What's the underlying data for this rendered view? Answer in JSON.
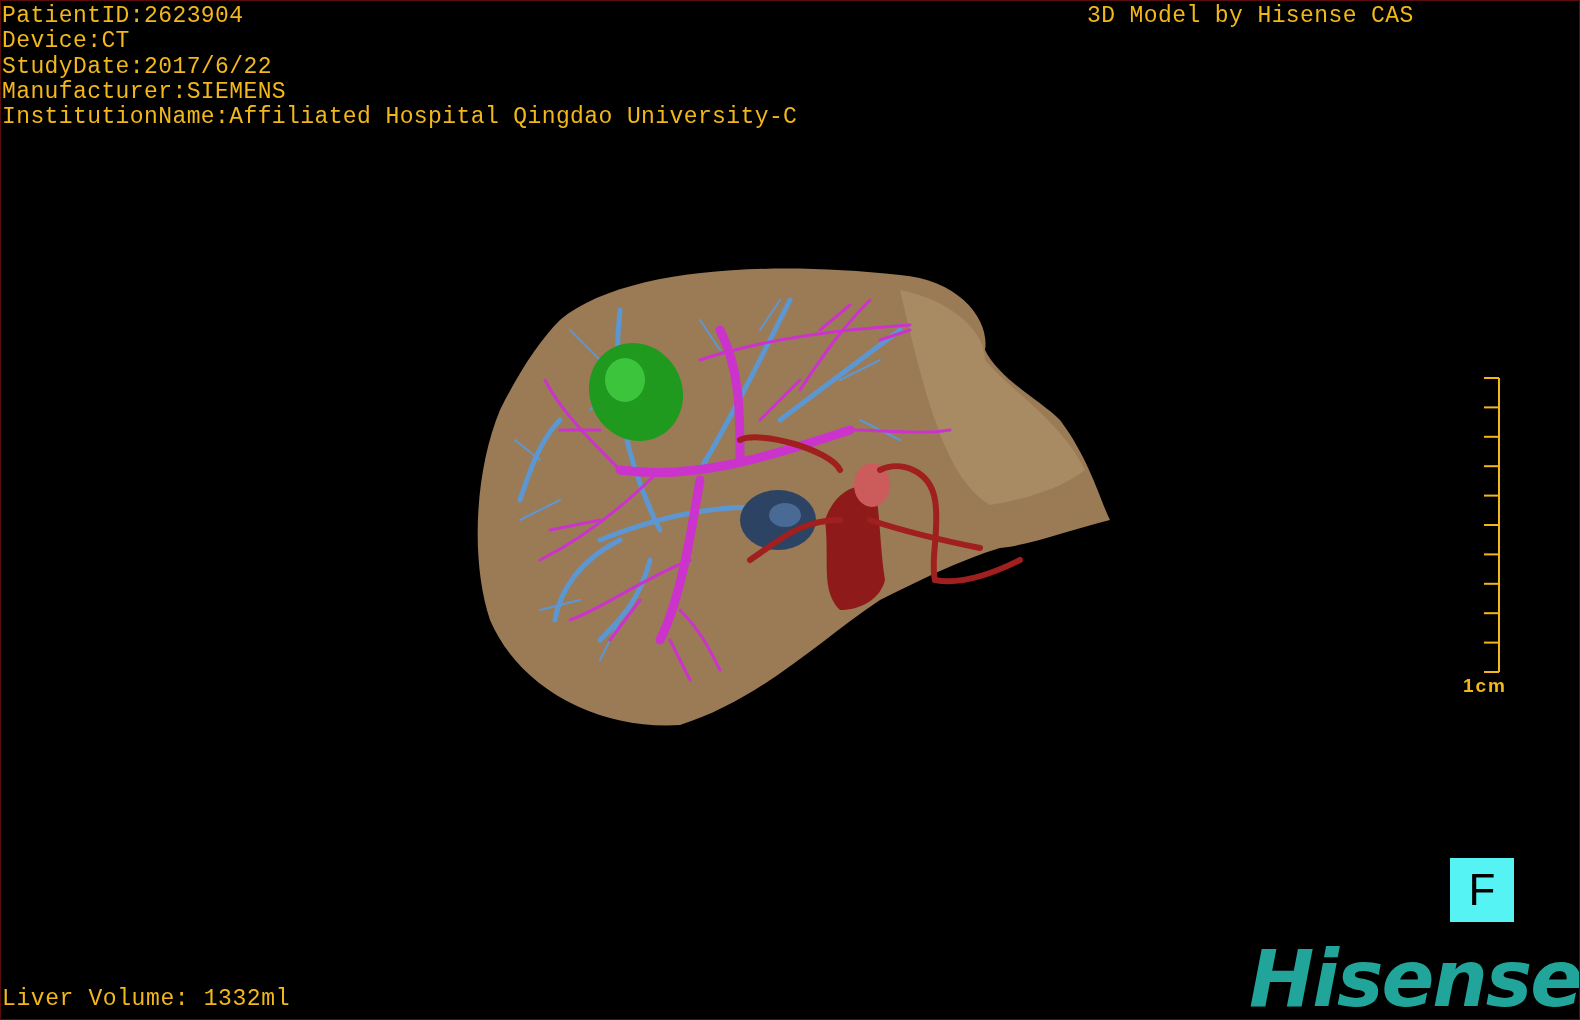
{
  "study_info": [
    "PatientID:2623904",
    "Device:CT",
    "StudyDate:2017/6/22",
    "Manufacturer:SIEMENS",
    "InstitutionName:Affiliated Hospital Qingdao University-C"
  ],
  "credit": "3D Model by Hisense CAS",
  "scale_bar": {
    "label": "1cm"
  },
  "orientation_button": {
    "label": "F"
  },
  "liver_volume": "Liver Volume: 1332ml",
  "brand": "Hisense"
}
